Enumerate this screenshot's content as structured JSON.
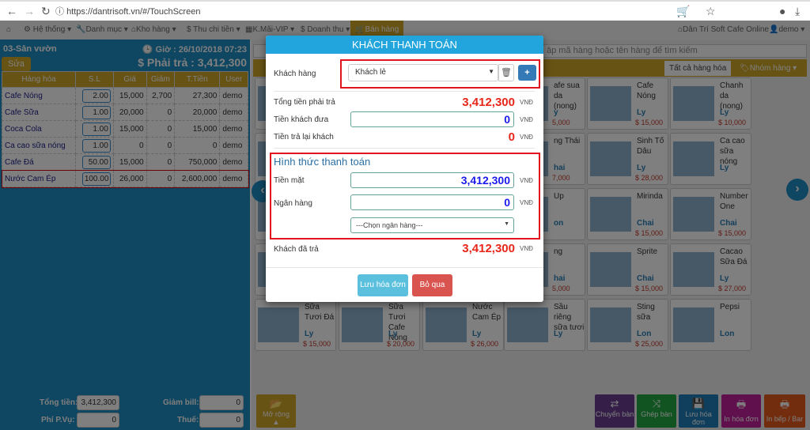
{
  "browser": {
    "url": "https://dantrisoft.vn/#/TouchScreen"
  },
  "navbar": {
    "items": [
      "Hệ thống",
      "Danh mục",
      "Kho hàng",
      "Thu chi tiền",
      "K.Mãi-VIP",
      "Doanh thu",
      "Bán hàng"
    ],
    "brand": "Dân Trí Soft Cafe Online",
    "user": "demo"
  },
  "order": {
    "table_name": "03-Sân vườn",
    "time": "Giờ : 26/10/2018 07:23",
    "edit_label": "Sửa",
    "total_label": "$ Phải trả : 3,412,300",
    "columns": [
      "Hàng hóa",
      "S.L",
      "Giá",
      "Giảm",
      "T.Tiền",
      "User"
    ],
    "rows": [
      [
        "Cafe Nóng",
        "2.00",
        "15,000",
        "2,700",
        "27,300",
        "demo"
      ],
      [
        "Cafe Sữa",
        "1.00",
        "20,000",
        "0",
        "20,000",
        "demo"
      ],
      [
        "Coca Cola",
        "1.00",
        "15,000",
        "0",
        "15,000",
        "demo"
      ],
      [
        "Ca cao sữa nóng",
        "1.00",
        "0",
        "0",
        "0",
        "demo"
      ],
      [
        "Cafe Đá",
        "50.00",
        "15,000",
        "0",
        "750,000",
        "demo"
      ],
      [
        "Nước Cam Ép",
        "100.00",
        "26,000",
        "0",
        "2,600,000",
        "demo"
      ]
    ]
  },
  "summary": {
    "total_label": "Tổng tiền:",
    "total": "3,412,300",
    "service_label": "Phí P.Vụ:",
    "service": "0",
    "discount_label": "Giảm bill:",
    "discount": "0",
    "tax_label": "Thuế:",
    "tax": "0"
  },
  "products": {
    "search_placeholder": "ập mã hàng hoặc tên hàng để tìm kiếm",
    "all_label": "Tất cả hàng hóa",
    "group_label": "Nhóm hàng",
    "items": [
      {
        "col": 3,
        "row": 0,
        "name": "afe sua da (nong)",
        "unit": "y",
        "price": "5,000"
      },
      {
        "col": 4,
        "row": 0,
        "name": "Cafe Nóng",
        "unit": "Ly",
        "price": "$ 15,000"
      },
      {
        "col": 5,
        "row": 0,
        "name": "Chanh da (nong)",
        "unit": "Ly",
        "price": "$ 10,000"
      },
      {
        "col": 3,
        "row": 1,
        "name": "ng Thái",
        "unit": "hai",
        "price": "7,000"
      },
      {
        "col": 4,
        "row": 1,
        "name": "Sinh Tố Dâu",
        "unit": "Ly",
        "price": "$ 28,000"
      },
      {
        "col": 5,
        "row": 1,
        "name": "Ca cao sữa nóng",
        "unit": "Ly",
        "price": ""
      },
      {
        "col": 3,
        "row": 2,
        "name": "Up",
        "unit": "on",
        "price": ""
      },
      {
        "col": 4,
        "row": 2,
        "name": "Mirinda",
        "unit": "Chai",
        "price": "$ 15,000"
      },
      {
        "col": 5,
        "row": 2,
        "name": "Number One",
        "unit": "Chai",
        "price": "$ 15,000"
      },
      {
        "col": 3,
        "row": 3,
        "name": "ng",
        "unit": "hai",
        "price": "5,000"
      },
      {
        "col": 4,
        "row": 3,
        "name": "Sprite",
        "unit": "Chai",
        "price": "$ 15,000"
      },
      {
        "col": 5,
        "row": 3,
        "name": "Cacao Sữa Đá",
        "unit": "Ly",
        "price": "$ 27,000"
      },
      {
        "col": 0,
        "row": 4,
        "name": "Sữa Tươi Đá",
        "unit": "Ly",
        "price": "$ 15,000"
      },
      {
        "col": 1,
        "row": 4,
        "name": "Sữa Tươi Cafe Nóng",
        "unit": "Ly",
        "price": "$ 20,000"
      },
      {
        "col": 2,
        "row": 4,
        "name": "Nước Cam Ép",
        "unit": "Ly",
        "price": "$ 26,000"
      },
      {
        "col": 3,
        "row": 4,
        "name": "Sầu riêng sữa tươi",
        "unit": "Ly",
        "price": ""
      },
      {
        "col": 4,
        "row": 4,
        "name": "Sting sữa",
        "unit": "Lon",
        "price": "$ 25,000"
      },
      {
        "col": 5,
        "row": 4,
        "name": "Pepsi",
        "unit": "Lon",
        "price": ""
      }
    ]
  },
  "actions": {
    "expand": "Mở rộng",
    "buttons": [
      {
        "label": "Chuyển bàn",
        "color": "#6a3f91",
        "icon": "⇄"
      },
      {
        "label": "Ghép bàn",
        "color": "#23a844",
        "icon": "⤨"
      },
      {
        "label": "Lưu hóa đơn",
        "color": "#1f7fb8",
        "icon": "💾"
      },
      {
        "label": "In hóa đơn",
        "color": "#c0219b",
        "icon": "🖶"
      },
      {
        "label": "In bếp / Bar",
        "color": "#e45a1f",
        "icon": "🖶"
      }
    ]
  },
  "modal": {
    "title": "KHÁCH THANH TOÁN",
    "customer_label": "Khách hàng",
    "customer": "Khách lẻ",
    "total_label": "Tổng tiền phải trả",
    "total": "3,412,300",
    "given_label": "Tiền khách đưa",
    "given": "0",
    "change_label": "Tiền trả lại khách",
    "change": "0",
    "currency": "VNĐ",
    "method_title": "Hình thức thanh toán",
    "cash_label": "Tiền mặt",
    "cash": "3,412,300",
    "bank_label": "Ngân hàng",
    "bank": "0",
    "bank_select": "---Chọn ngân hàng---",
    "paid_label": "Khách đã trả",
    "paid": "3,412,300",
    "save": "Lưu hóa đơn",
    "cancel": "Bỏ qua"
  }
}
